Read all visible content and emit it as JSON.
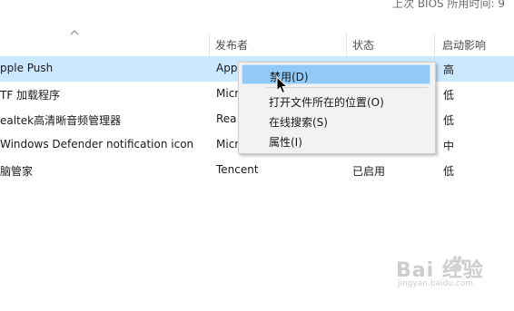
{
  "top_info": "上次 BIOS 所用时间: 9",
  "columns": {
    "name_sort_icon": "chevron-up-icon",
    "publisher": "发布者",
    "status": "状态",
    "startup_impact": "启动影响"
  },
  "rows": [
    {
      "name": "pple Push",
      "publisher": "App",
      "status": "",
      "impact": "高",
      "selected": true
    },
    {
      "name": "TF 加载程序",
      "publisher": "Micr",
      "status": "",
      "impact": "低"
    },
    {
      "name": "ealtek高清晰音频管理器",
      "publisher": "Rea",
      "status": "",
      "impact": "低"
    },
    {
      "name": "Windows Defender notification icon",
      "publisher": "Micr",
      "status": "",
      "impact": "中"
    },
    {
      "name": "脑管家",
      "publisher": "Tencent",
      "status": "已启用",
      "impact": "低"
    }
  ],
  "context_menu": {
    "items": [
      "禁用(D)",
      "打开文件所在的位置(O)",
      "在线搜索(S)",
      "属性(I)"
    ],
    "highlighted_index": 0
  },
  "watermark": {
    "brand": "Bai 经验",
    "sub": "jingyan.baidu.com"
  },
  "colors": {
    "selected_row": "#cce8ff",
    "menu_highlight": "#91c9f7"
  }
}
